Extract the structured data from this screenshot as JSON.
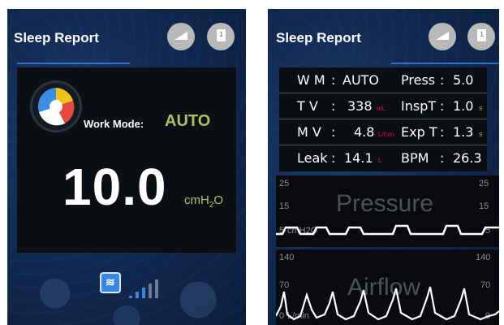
{
  "left": {
    "title": "Sleep Report",
    "work_mode_label": "Work Mode:",
    "work_mode_value": "AUTO",
    "pressure_value": "10.0",
    "pressure_unit": "cmH2O",
    "header_icons": [
      "signal-icon",
      "document-icon"
    ],
    "signal_bars_level": 3
  },
  "right": {
    "title": "Sleep Report",
    "params": [
      {
        "label": "W M",
        "sep": ":",
        "value": "AUTO",
        "unit": "",
        "label2": "Press",
        "sep2": ":",
        "value2": "5.0",
        "unit2": ""
      },
      {
        "label": "T  V",
        "sep": ":",
        "value": "338",
        "unit": "mL",
        "label2": "InspT",
        "sep2": ":",
        "value2": "1.0",
        "unit2": "s"
      },
      {
        "label": "M  V",
        "sep": ":",
        "value": "4.8",
        "unit": "L/min",
        "label2": "Exp T",
        "sep2": ":",
        "value2": "1.3",
        "unit2": "s"
      },
      {
        "label": "Leak",
        "sep": ":",
        "value": "14.1",
        "unit": "L",
        "label2": "BPM",
        "sep2": ":",
        "value2": "26.3",
        "unit2": ""
      }
    ],
    "pressure_graph": {
      "label": "Pressure",
      "ticks_left": [
        "25",
        "15",
        "5"
      ],
      "ticks_right": [
        "25",
        "15",
        "5"
      ],
      "unit": "cmH2O"
    },
    "airflow_graph": {
      "label": "Airflow",
      "ticks_left": [
        "140",
        "70",
        "0"
      ],
      "ticks_right": [
        "140",
        "70",
        "0"
      ],
      "unit": "L/min"
    }
  },
  "colors": {
    "accent_green": "#a9c267",
    "tab_blue": "#2f6fc6",
    "background": "#122a52"
  }
}
